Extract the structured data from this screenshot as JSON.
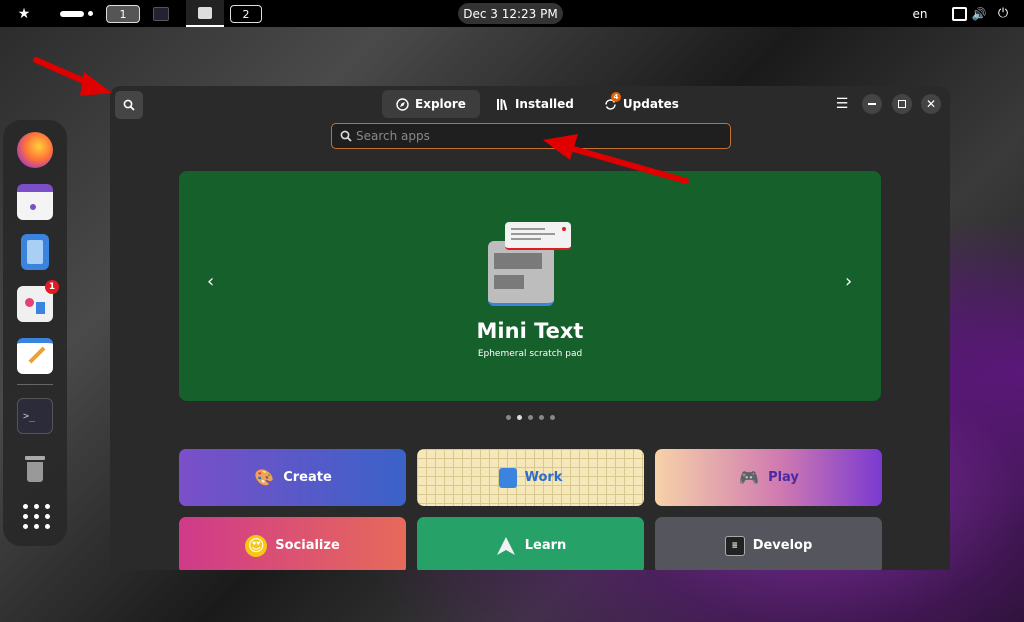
{
  "topbar": {
    "workspaces": [
      "1",
      "2"
    ],
    "clock": "Dec 3  12:23 PM",
    "language": "en"
  },
  "dock": {
    "items": [
      {
        "name": "firefox-icon"
      },
      {
        "name": "calendar-icon"
      },
      {
        "name": "files-icon"
      },
      {
        "name": "software-icon",
        "badge": "1"
      },
      {
        "name": "text-editor-icon"
      },
      {
        "name": "terminal-icon"
      },
      {
        "name": "trash-icon"
      },
      {
        "name": "app-grid-icon"
      }
    ]
  },
  "window": {
    "tabs": [
      {
        "label": "Explore",
        "icon": "compass-icon"
      },
      {
        "label": "Installed",
        "icon": "library-icon"
      },
      {
        "label": "Updates",
        "icon": "updates-icon",
        "badge": "4"
      }
    ],
    "search": {
      "placeholder": "Search apps"
    },
    "banner": {
      "title": "Mini Text",
      "subtitle": "Ephemeral scratch pad",
      "color": "#16602c",
      "prev": "‹",
      "next": "›"
    },
    "categories": [
      {
        "label": "Create",
        "icon": "create-icon"
      },
      {
        "label": "Work",
        "icon": "work-icon"
      },
      {
        "label": "Play",
        "icon": "gamepad-icon"
      },
      {
        "label": "Socialize",
        "icon": "emoji-icon"
      },
      {
        "label": "Learn",
        "icon": "paper-plane-icon"
      },
      {
        "label": "Develop",
        "icon": "code-icon"
      }
    ]
  },
  "colors": {
    "accent": "#c67030",
    "annotation": "#e00000"
  }
}
